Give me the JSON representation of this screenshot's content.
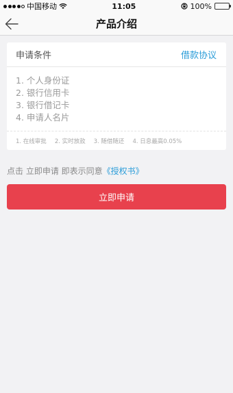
{
  "status_bar": {
    "carrier": "中国移动",
    "time": "11:05",
    "battery": "100%",
    "battery_level": 1.0
  },
  "nav": {
    "title": "产品介绍",
    "back_icon": "back-arrow-icon"
  },
  "card": {
    "title": "申请条件",
    "link": "借款协议",
    "requirements": [
      "1. 个人身份证",
      "2. 银行信用卡",
      "3. 银行借记卡",
      "4. 申请人名片"
    ],
    "features": [
      "1. 在线审批",
      "2. 实时放款",
      "3. 随借随还",
      "4. 日息最高0.05%"
    ]
  },
  "agreement": {
    "text": "点击 立即申请 即表示同意",
    "link": "《授权书》"
  },
  "apply_button": "立即申请",
  "colors": {
    "accent": "#2a9cd8",
    "button": "#e8414d",
    "battery": "#4cd964"
  }
}
